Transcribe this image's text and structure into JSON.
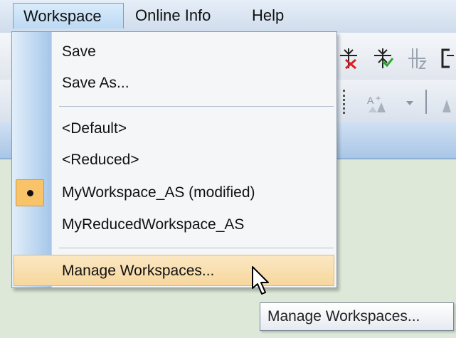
{
  "menubar": {
    "items": [
      {
        "label": "Workspace"
      },
      {
        "label": "Online Info"
      },
      {
        "label": "Help"
      }
    ]
  },
  "workspace_menu": {
    "items": [
      {
        "label": "Save"
      },
      {
        "label": "Save As..."
      },
      {
        "label": "<Default>"
      },
      {
        "label": "<Reduced>"
      },
      {
        "label": "MyWorkspace_AS (modified)",
        "checked": true
      },
      {
        "label": "MyReducedWorkspace_AS"
      },
      {
        "label": "Manage Workspaces...",
        "highlighted": true
      }
    ]
  },
  "tooltip": {
    "text": "Manage Workspaces..."
  },
  "toolbar_icons": [
    "filter-remove-icon",
    "filter-add-icon",
    "filter-disabled-icon",
    "bracket-icon",
    "sort-ascending-icon",
    "dropdown-arrow-icon",
    "sort-icon"
  ],
  "colors": {
    "menu_highlight": "#f7d79d",
    "checked_background": "#f9c36a",
    "gutter_blue": "#b7d3ef",
    "active_menu_border": "#6f9fcf"
  }
}
